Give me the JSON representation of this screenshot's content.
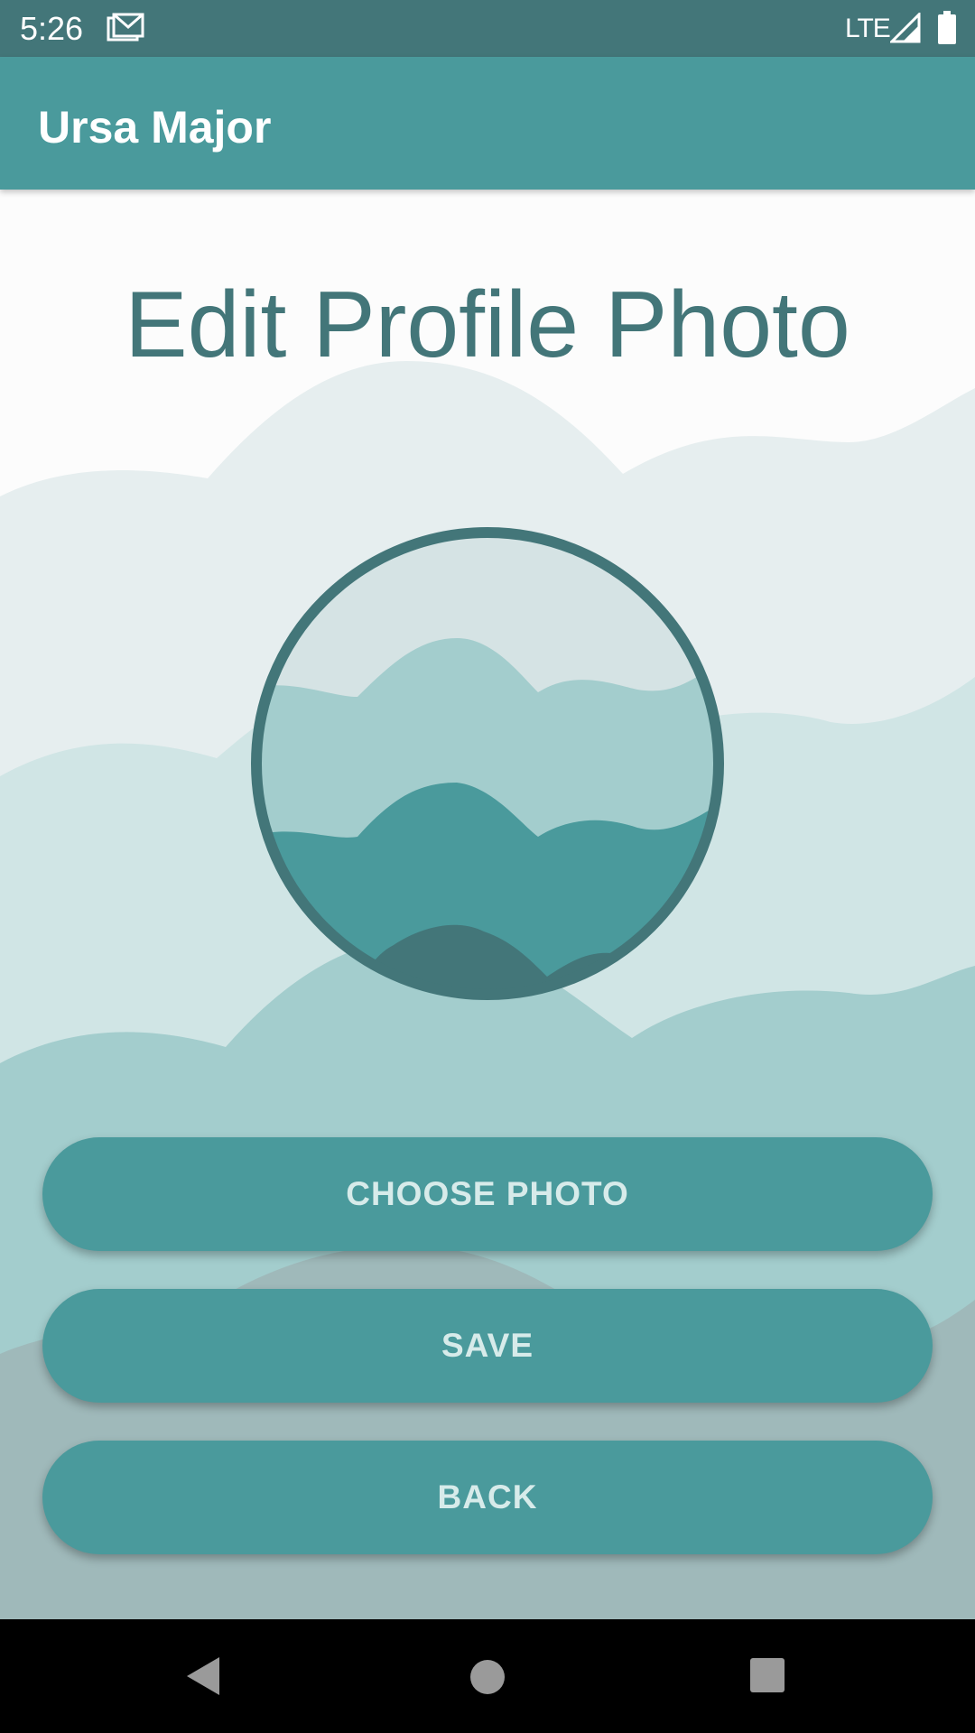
{
  "status_bar": {
    "time": "5:26",
    "network": "LTE",
    "icons": [
      "mail-icon",
      "signal-icon",
      "battery-icon"
    ]
  },
  "app_bar": {
    "title": "Ursa Major"
  },
  "main": {
    "title": "Edit Profile Photo",
    "avatar_icon": "landscape-placeholder-icon",
    "buttons": {
      "choose_photo": "CHOOSE PHOTO",
      "save": "SAVE",
      "back": "BACK"
    }
  },
  "nav_bar": {
    "icons": [
      "back-icon",
      "home-icon",
      "recents-icon"
    ]
  },
  "colors": {
    "primary": "#4a9a9c",
    "primary_dark": "#437679",
    "button_text": "#d7ebea",
    "wave_light": "#e6eeef",
    "wave_mid": "#d0e5e5",
    "wave_teal": "#a3cdcd",
    "wave_gray": "#9fb9ba"
  }
}
